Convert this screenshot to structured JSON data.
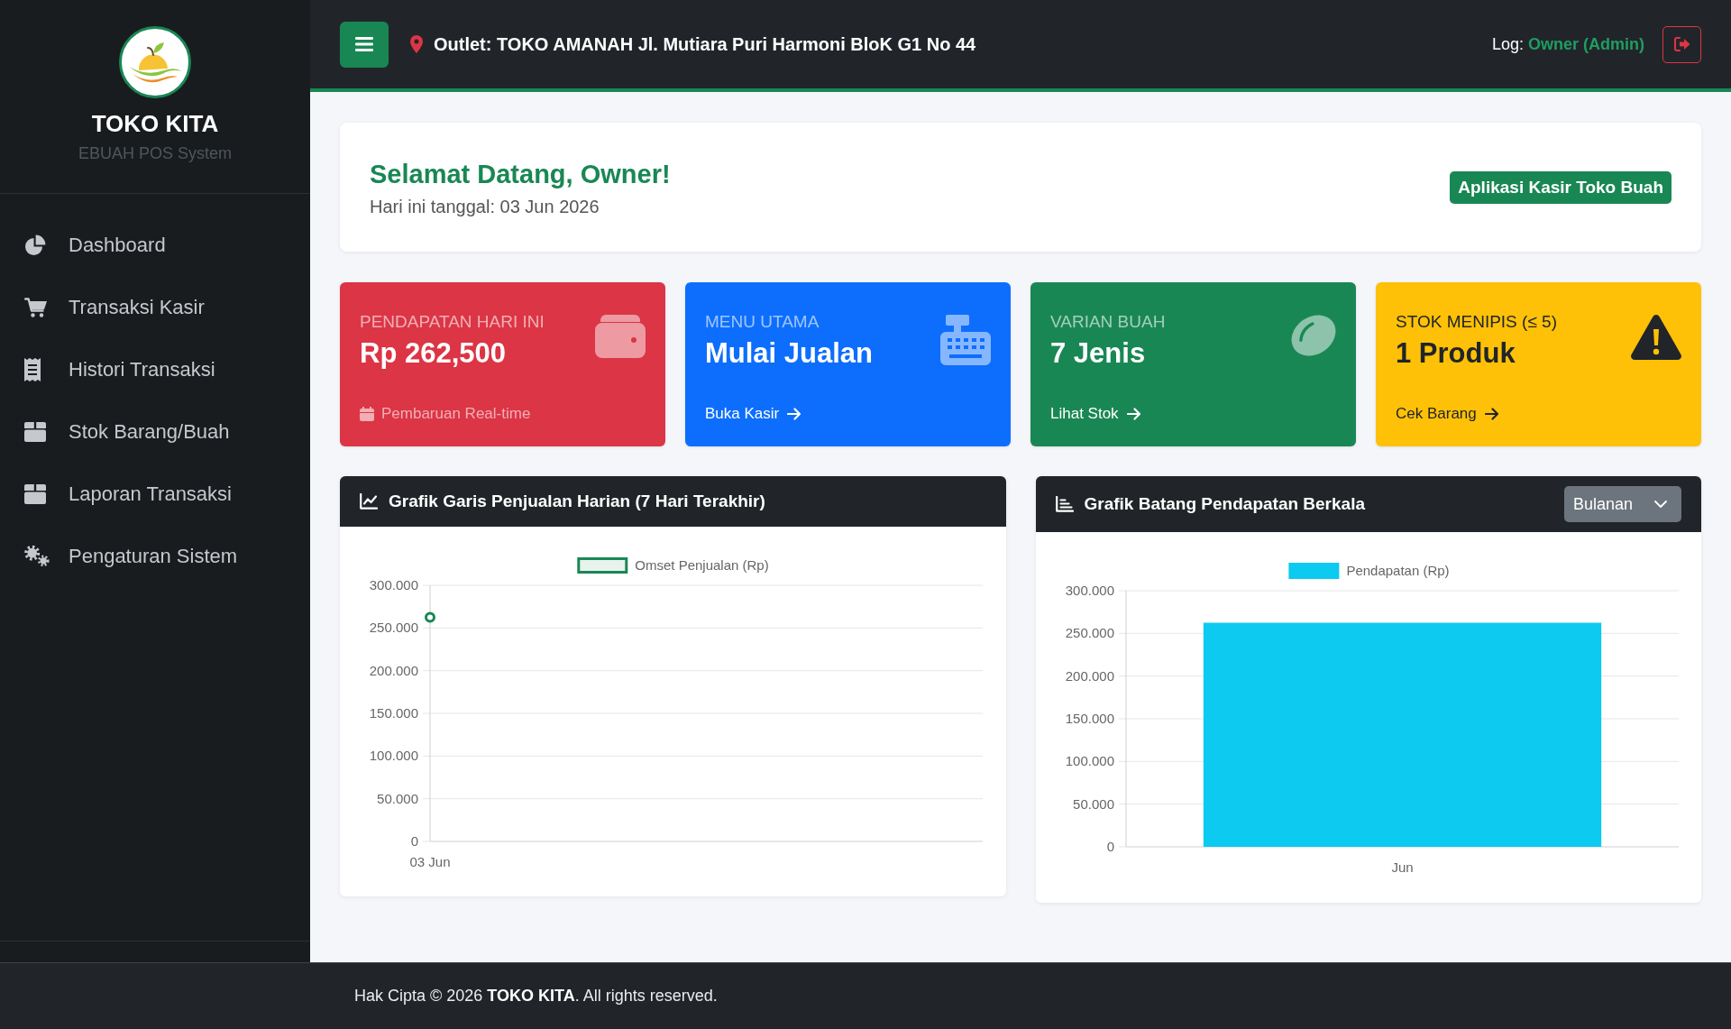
{
  "sidebar": {
    "brand": "TOKO KITA",
    "subtitle": "EBUAH POS System",
    "items": [
      {
        "label": "Dashboard"
      },
      {
        "label": "Transaksi Kasir"
      },
      {
        "label": "Histori Transaksi"
      },
      {
        "label": "Stok Barang/Buah"
      },
      {
        "label": "Laporan Transaksi"
      },
      {
        "label": "Pengaturan Sistem"
      }
    ]
  },
  "topbar": {
    "outlet": "Outlet: TOKO AMANAH Jl. Mutiara Puri Harmoni BloK G1 No 44",
    "log_label": "Log:",
    "user": "Owner (Admin)"
  },
  "welcome": {
    "title": "Selamat Datang, Owner!",
    "date": "Hari ini tanggal: 03 Jun 2026",
    "button": "Aplikasi Kasir Toko Buah"
  },
  "stats": [
    {
      "title": "PENDAPATAN HARI INI",
      "value": "Rp 262,500",
      "footer": "Pembaruan Real-time",
      "kind": "note",
      "color": "#dc3545"
    },
    {
      "title": "MENU UTAMA",
      "value": "Mulai Jualan",
      "footer": "Buka Kasir",
      "kind": "link",
      "color": "#0d6efd"
    },
    {
      "title": "VARIAN BUAH",
      "value": "7 Jenis",
      "footer": "Lihat Stok",
      "kind": "link",
      "color": "#198754"
    },
    {
      "title": "STOK MENIPIS (≤ 5)",
      "value": "1 Produk",
      "footer": "Cek Barang",
      "kind": "link",
      "color": "#ffc107"
    }
  ],
  "charts": [
    {
      "title": "Grafik Garis Penjualan Harian (7 Hari Terakhir)",
      "chart_data": {
        "type": "line",
        "grid": true,
        "categories": [
          "03 Jun"
        ],
        "series": [
          {
            "name": "Omset Penjualan (Rp)",
            "color": "#198754",
            "marker": true,
            "values": [
              262500
            ]
          }
        ],
        "ylim": [
          0,
          300000
        ],
        "yticks": [
          {
            "value": 0,
            "label": "0"
          },
          {
            "value": 50000,
            "label": "50.000"
          },
          {
            "value": 100000,
            "label": "100.000"
          },
          {
            "value": 150000,
            "label": "150.000"
          },
          {
            "value": 200000,
            "label": "200.000"
          },
          {
            "value": 250000,
            "label": "250.000"
          },
          {
            "value": 300000,
            "label": "300.000"
          }
        ]
      }
    },
    {
      "title": "Grafik Batang Pendapatan Berkala",
      "period_select": "Bulanan",
      "chart_data": {
        "type": "bar",
        "grid": true,
        "categories": [
          "Jun"
        ],
        "series": [
          {
            "name": "Pendapatan (Rp)",
            "color": "#0dcaf0",
            "values": [
              262500
            ]
          }
        ],
        "ylim": [
          0,
          300000
        ],
        "yticks": [
          {
            "value": 0,
            "label": "0"
          },
          {
            "value": 50000,
            "label": "50.000"
          },
          {
            "value": 100000,
            "label": "100.000"
          },
          {
            "value": 150000,
            "label": "150.000"
          },
          {
            "value": 200000,
            "label": "200.000"
          },
          {
            "value": 250000,
            "label": "250.000"
          },
          {
            "value": 300000,
            "label": "300.000"
          }
        ]
      }
    }
  ],
  "footer": {
    "text": "Hak Cipta © 2026 **TOKO KITA**. All rights reserved."
  }
}
